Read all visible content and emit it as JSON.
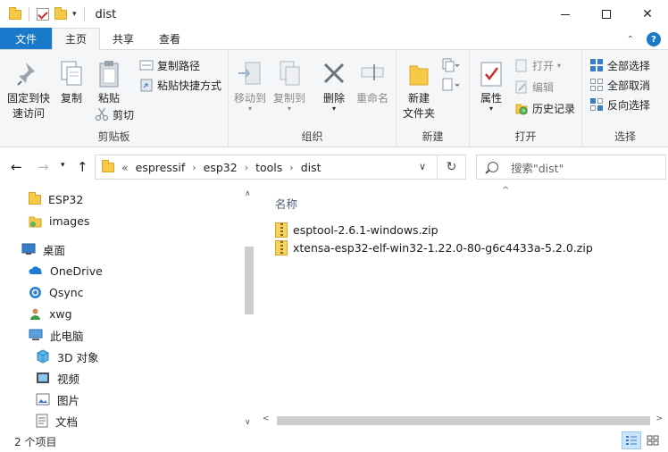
{
  "window": {
    "title": "dist"
  },
  "tabs": {
    "file": "文件",
    "home": "主页",
    "share": "共享",
    "view": "查看"
  },
  "ribbon": {
    "clipboard": {
      "pin": [
        "固定到快",
        "速访问"
      ],
      "copy": "复制",
      "paste": "粘贴",
      "copy_path": "复制路径",
      "paste_shortcut": "粘贴快捷方式",
      "cut": "剪切",
      "label": "剪贴板"
    },
    "organize": {
      "move_to": "移动到",
      "copy_to": "复制到",
      "delete": "删除",
      "rename": "重命名",
      "label": "组织"
    },
    "new": {
      "new_folder": [
        "新建",
        "文件夹"
      ],
      "label": "新建"
    },
    "open": {
      "properties": "属性",
      "open": "打开",
      "edit": "编辑",
      "history": "历史记录",
      "label": "打开"
    },
    "select": {
      "select_all": "全部选择",
      "select_none": "全部取消",
      "invert": "反向选择",
      "label": "选择"
    }
  },
  "address": {
    "overflow": "«",
    "crumbs": [
      "espressif",
      "esp32",
      "tools",
      "dist"
    ],
    "search_placeholder": "搜索\"dist\""
  },
  "nav": {
    "items": [
      "ESP32",
      "images",
      "桌面",
      "OneDrive",
      "Qsync",
      "xwg",
      "此电脑",
      "3D 对象",
      "视频",
      "图片",
      "文档"
    ]
  },
  "content": {
    "column_name": "名称",
    "files": [
      "esptool-2.6.1-windows.zip",
      "xtensa-esp32-elf-win32-1.22.0-80-g6c4433a-5.2.0.zip"
    ]
  },
  "status": {
    "count": "2 个项目"
  },
  "colors": {
    "accent": "#1979ca",
    "ribbon_bg": "#f5f6f7",
    "folder": "#f7c948"
  }
}
